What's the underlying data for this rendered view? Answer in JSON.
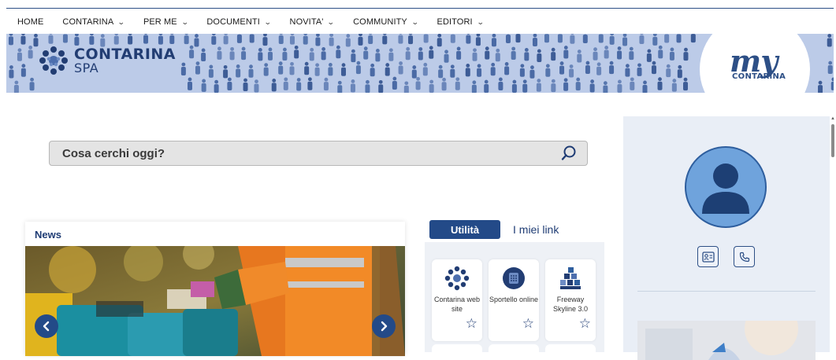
{
  "nav": {
    "items": [
      {
        "label": "HOME",
        "has_dropdown": false
      },
      {
        "label": "CONTARINA",
        "has_dropdown": true
      },
      {
        "label": "PER ME",
        "has_dropdown": true
      },
      {
        "label": "DOCUMENTI",
        "has_dropdown": true
      },
      {
        "label": "NOVITA'",
        "has_dropdown": true
      },
      {
        "label": "COMMUNITY",
        "has_dropdown": true
      },
      {
        "label": "EDITORI",
        "has_dropdown": true
      }
    ]
  },
  "banner": {
    "logo_name": "CONTARINA",
    "logo_sub": "SPA",
    "my_word": "my",
    "my_sub": "CONTARINA",
    "bg_color": "#bccbe8"
  },
  "search": {
    "placeholder": "Cosa cerchi oggi?",
    "icon": "search-icon"
  },
  "news": {
    "title": "News",
    "prev_icon": "chevron-left-icon",
    "next_icon": "chevron-right-icon"
  },
  "tabs": {
    "active": "Utilità",
    "other": "I miei link"
  },
  "links": [
    {
      "label": "Contarina web site",
      "icon": "contarina-logo-icon"
    },
    {
      "label": "Sportello online",
      "icon": "sportello-icon"
    },
    {
      "label": "Freeway Skyline 3.0",
      "icon": "freeway-icon"
    }
  ],
  "sidebar": {
    "avatar_icon": "user-avatar-icon",
    "contact_icons": [
      "id-card-icon",
      "phone-icon"
    ]
  },
  "colors": {
    "primary": "#234a88",
    "accent": "#1f3c74",
    "panel": "#e9eef6"
  }
}
